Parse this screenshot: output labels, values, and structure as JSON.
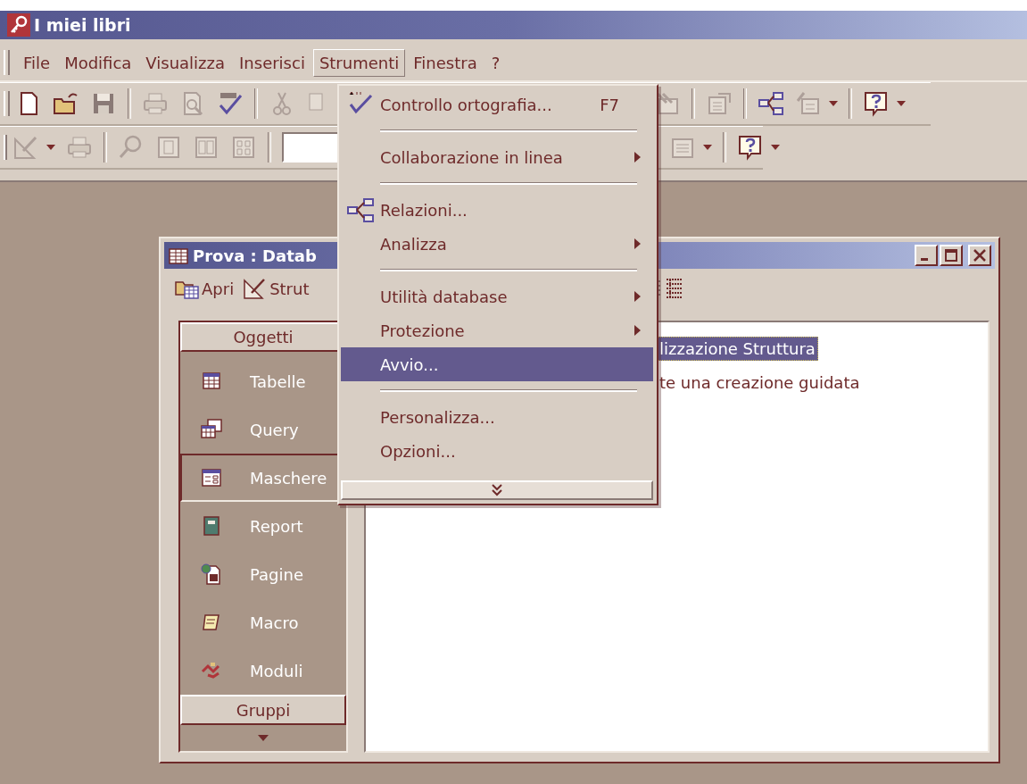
{
  "window": {
    "title": "I miei libri"
  },
  "menu_bar": [
    {
      "label": "File",
      "selected": false
    },
    {
      "label": "Modifica",
      "selected": false
    },
    {
      "label": "Visualizza",
      "selected": false
    },
    {
      "label": "Inserisci",
      "selected": false
    },
    {
      "label": "Strumenti",
      "selected": true
    },
    {
      "label": "Finestra",
      "selected": false
    },
    {
      "label": "?",
      "selected": false
    }
  ],
  "toolbar_1": {
    "left": [
      {
        "kind": "new",
        "disabled": false
      },
      {
        "kind": "open",
        "disabled": false
      },
      {
        "kind": "save",
        "disabled": false
      },
      {
        "kind": "separator"
      },
      {
        "kind": "print",
        "disabled": true
      },
      {
        "kind": "preview",
        "disabled": true
      },
      {
        "kind": "spelling",
        "disabled": false
      },
      {
        "kind": "separator"
      },
      {
        "kind": "cut",
        "disabled": true
      },
      {
        "kind": "copy",
        "disabled": true
      }
    ],
    "right": [
      {
        "kind": "analyze",
        "disabled": true
      },
      {
        "kind": "separator"
      },
      {
        "kind": "properties",
        "disabled": true
      },
      {
        "kind": "separator"
      },
      {
        "kind": "relations",
        "disabled": false
      },
      {
        "kind": "new-object",
        "disabled": true
      },
      {
        "kind": "dropdown"
      },
      {
        "kind": "separator"
      },
      {
        "kind": "help",
        "disabled": false
      },
      {
        "kind": "dropdown"
      }
    ]
  },
  "toolbar_2": {
    "left": [
      {
        "kind": "design",
        "disabled": true
      },
      {
        "kind": "dropdown"
      },
      {
        "kind": "print",
        "disabled": true
      },
      {
        "kind": "separator"
      },
      {
        "kind": "zoom",
        "disabled": true
      },
      {
        "kind": "one-page",
        "disabled": true
      },
      {
        "kind": "two-pages",
        "disabled": true
      },
      {
        "kind": "multi-page",
        "disabled": true
      },
      {
        "kind": "separator"
      },
      {
        "kind": "combo"
      }
    ],
    "right": [
      {
        "kind": "view",
        "disabled": true
      },
      {
        "kind": "dropdown"
      },
      {
        "kind": "separator"
      },
      {
        "kind": "help",
        "disabled": false
      },
      {
        "kind": "dropdown"
      }
    ]
  },
  "menu": [
    {
      "kind": "spelling",
      "label": "Controllo ortografia...",
      "shortcut": "F7",
      "submenu": false,
      "selected": false
    },
    {
      "kind": "separator"
    },
    {
      "kind": "plain",
      "label": "Collaborazione in linea",
      "submenu": true,
      "selected": false
    },
    {
      "kind": "separator"
    },
    {
      "kind": "relations",
      "label": "Relazioni...",
      "submenu": false,
      "selected": false
    },
    {
      "kind": "plain",
      "label": "Analizza",
      "submenu": true,
      "selected": false
    },
    {
      "kind": "separator"
    },
    {
      "kind": "plain",
      "label": "Utilità database",
      "submenu": true,
      "selected": false
    },
    {
      "kind": "plain",
      "label": "Protezione",
      "submenu": true,
      "selected": false
    },
    {
      "kind": "plain",
      "label": "Avvio...",
      "submenu": false,
      "selected": true
    },
    {
      "kind": "separator"
    },
    {
      "kind": "plain",
      "label": "Personalizza...",
      "submenu": false,
      "selected": false
    },
    {
      "kind": "plain",
      "label": "Opzioni...",
      "submenu": false,
      "selected": false
    },
    {
      "kind": "expand"
    }
  ],
  "database_window": {
    "title": "Prova : Datab",
    "toolbar": [
      {
        "kind": "open",
        "label": "Apri"
      },
      {
        "kind": "design",
        "label": "Strut"
      }
    ],
    "sidebar": {
      "header": "Oggetti",
      "items": [
        {
          "kind": "tables",
          "label": "Tabelle",
          "selected": false
        },
        {
          "kind": "queries",
          "label": "Query",
          "selected": false
        },
        {
          "kind": "forms",
          "label": "Maschere",
          "selected": true
        },
        {
          "kind": "reports",
          "label": "Report",
          "selected": false
        },
        {
          "kind": "pages",
          "label": "Pagine",
          "selected": false
        },
        {
          "kind": "macros",
          "label": "Macro",
          "selected": false
        },
        {
          "kind": "modules",
          "label": "Moduli",
          "selected": false
        }
      ],
      "footer": "Gruppi"
    },
    "objects": [
      {
        "label": "lizzazione Struttura",
        "selected": true
      },
      {
        "label": "te una creazione guidata",
        "selected": false
      }
    ]
  }
}
